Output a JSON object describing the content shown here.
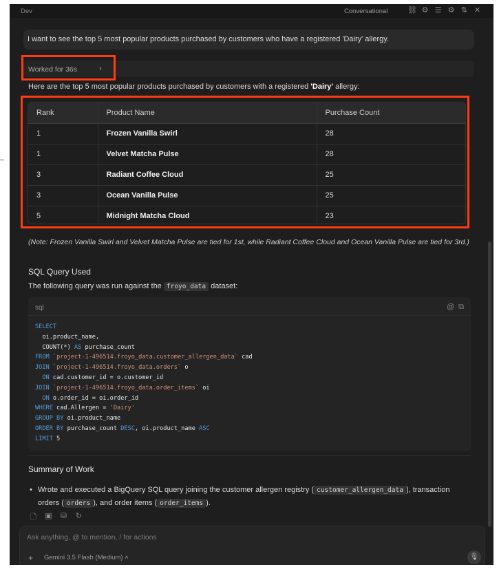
{
  "window": {
    "title": "Dev",
    "mode": "Conversational",
    "toolbar_icons": [
      "link-icon",
      "settings-icon",
      "list-icon",
      "gear-icon",
      "tune-icon",
      "close-icon"
    ]
  },
  "chat": {
    "user_message": "I want to see the top 5 most popular products purchased by customers who have a registered 'Dairy' allergy.",
    "worked_label": "Worked for 36s",
    "intro_prefix": "Here are the top 5 most popular products purchased by customers with a registered ",
    "intro_bold": "'Dairy'",
    "intro_suffix": " allergy:"
  },
  "results_table": {
    "headers": [
      "Rank",
      "Product Name",
      "Purchase Count"
    ],
    "rows": [
      [
        "1",
        "Frozen Vanilla Swirl",
        "28"
      ],
      [
        "1",
        "Velvet Matcha Pulse",
        "28"
      ],
      [
        "3",
        "Radiant Coffee Cloud",
        "25"
      ],
      [
        "3",
        "Ocean Vanilla Pulse",
        "25"
      ],
      [
        "5",
        "Midnight Matcha Cloud",
        "23"
      ]
    ]
  },
  "note": "(Note: Frozen Vanilla Swirl and Velvet Matcha Pulse are tied for 1st, while Radiant Coffee Cloud and Ocean Vanilla Pulse are tied for 3rd.)",
  "sql_section": {
    "heading": "SQL Query Used",
    "intro_prefix": "The following query was run against the ",
    "dataset": "froyo_data",
    "intro_suffix": " dataset:",
    "code_lang": "sql",
    "code_lines": [
      "SELECT",
      "  oi.product_name,",
      "  COUNT(*) AS purchase_count",
      "FROM `project-1-496514.froyo_data.customer_allergen_data` cad",
      "JOIN `project-1-496514.froyo_data.orders` o",
      "  ON cad.customer_id = o.customer_id",
      "JOIN `project-1-496514.froyo_data.order_items` oi",
      "  ON o.order_id = oi.order_id",
      "WHERE cad.Allergen = 'Dairy'",
      "GROUP BY oi.product_name",
      "ORDER BY purchase_count DESC, oi.product_name ASC",
      "LIMIT 5"
    ]
  },
  "summary": {
    "heading": "Summary of Work",
    "bullet_1_a": "Wrote and executed a BigQuery SQL query joining the customer allergen registry (",
    "bullet_1_code_1": "customer_allergen_data",
    "bullet_1_b": "), transaction orders (",
    "bullet_1_code_2": "orders",
    "bullet_1_c": "), and order items (",
    "bullet_1_code_3": "order_items",
    "bullet_1_d": ")."
  },
  "composer": {
    "placeholder": "Ask anything, @ to mention, / for actions",
    "model": "Gemini 3.5 Flash (Medium)"
  },
  "colors": {
    "highlight": "#ff3d10",
    "background": "#1e1e1e",
    "keyword": "#569cd6",
    "string": "#ce9178"
  }
}
